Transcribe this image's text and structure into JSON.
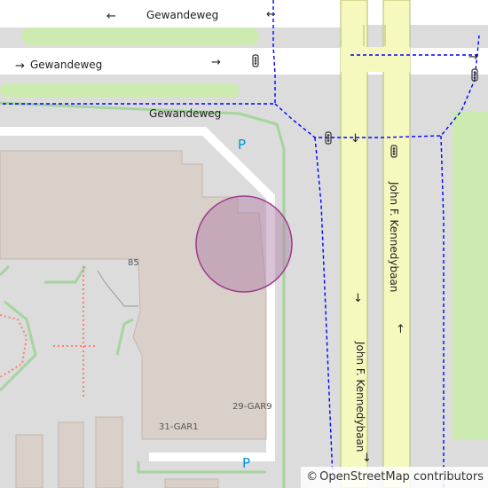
{
  "map": {
    "streets": {
      "top_gewandeweg": "Gewandeweg",
      "mid_gewandeweg": "Gewandeweg",
      "lower_gewandeweg": "Gewandeweg",
      "kennedy_north": "John F. Kennedybaan",
      "kennedy_south": "John F. Kennedybaan"
    },
    "oneway_arrows": {
      "left": "←",
      "right": "→",
      "down": "↓",
      "up": "↑"
    },
    "parking_label": "P",
    "house_number": "85",
    "building_refs": [
      "29-GAR9",
      "31-GAR1"
    ],
    "colors": {
      "background": "#dcdcdc",
      "road_main": "#f6f9be",
      "road_main_casing": "#b7bb6b",
      "road_minor": "#ffffff",
      "building": "#d9d0c9",
      "building_outline": "#c4b6ab",
      "grass": "#cdebb0",
      "footway": "#a6d49e",
      "cycleway": "#0000ff",
      "path_red": "#fa8072",
      "parking_label": "#0092da",
      "marker_fill": "#b07ba6",
      "marker_stroke": "#9d3a8f"
    }
  },
  "attribution": {
    "symbol": "©",
    "text": "OpenStreetMap contributors"
  }
}
